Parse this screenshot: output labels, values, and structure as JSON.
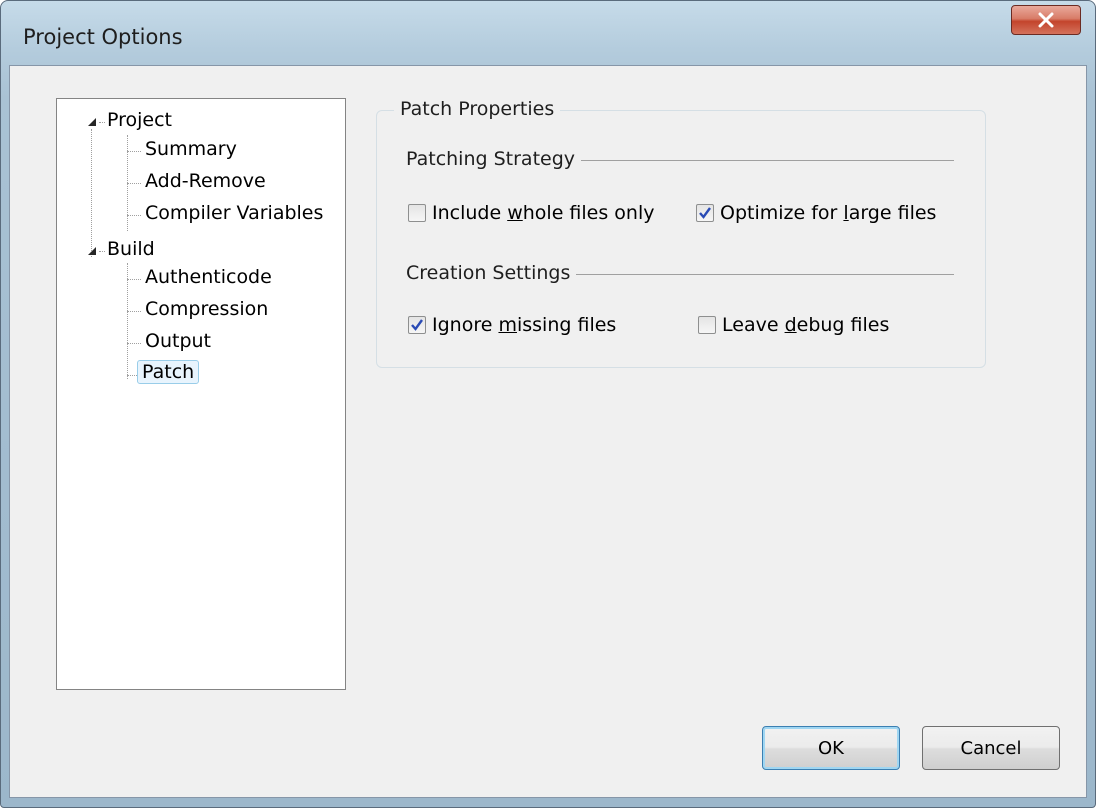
{
  "window": {
    "title": "Project Options"
  },
  "tree": {
    "project": {
      "label": "Project",
      "children": [
        "Summary",
        "Add-Remove",
        "Compiler Variables"
      ]
    },
    "build": {
      "label": "Build",
      "children": [
        "Authenticode",
        "Compression",
        "Output",
        "Patch"
      ]
    },
    "selected": "Patch"
  },
  "patch_properties": {
    "title": "Patch Properties",
    "patching_strategy": {
      "title": "Patching Strategy",
      "include_whole_files": {
        "pre": "Include ",
        "mn": "w",
        "post": "hole files only",
        "checked": false
      },
      "optimize_large_files": {
        "pre": "Optimize for ",
        "mn": "l",
        "post": "arge files",
        "checked": true
      }
    },
    "creation_settings": {
      "title": "Creation Settings",
      "ignore_missing_files": {
        "pre": "Ignore ",
        "mn": "m",
        "post": "issing files",
        "checked": true
      },
      "leave_debug_files": {
        "pre": "Leave ",
        "mn": "d",
        "post": "ebug files",
        "checked": false
      }
    }
  },
  "buttons": {
    "ok": "OK",
    "cancel": "Cancel"
  },
  "colors": {
    "selection_bg": "#e8f4fd",
    "selection_border": "#99cde9",
    "close_button": "#c3442c"
  }
}
